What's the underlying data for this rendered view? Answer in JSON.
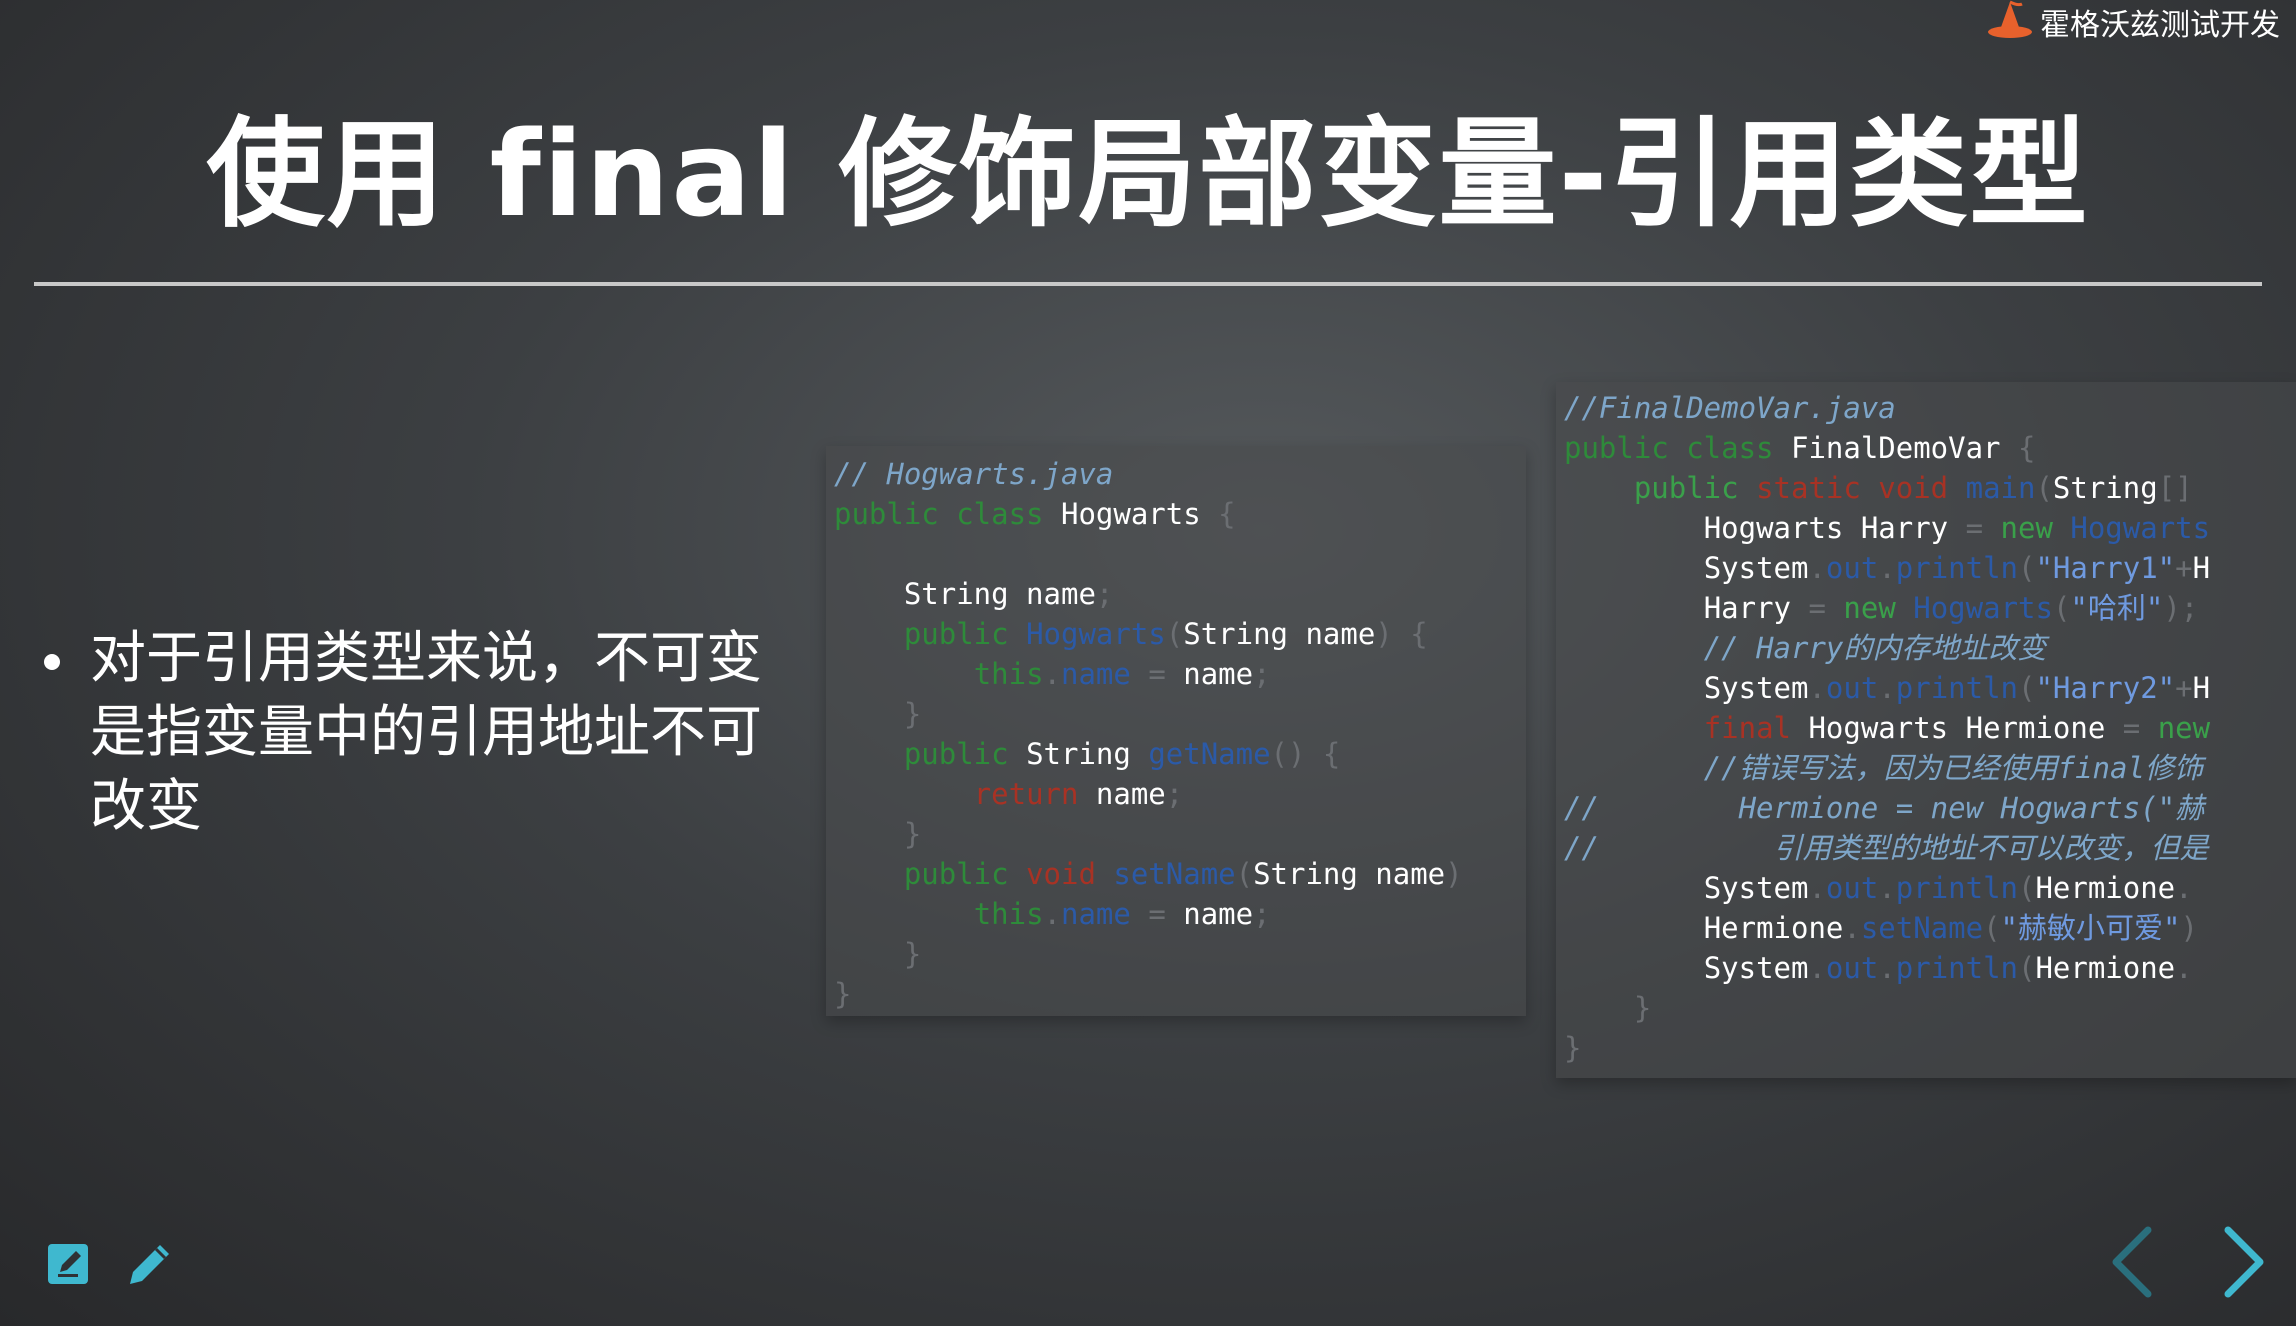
{
  "logo": {
    "text": "霍格沃兹测试开发"
  },
  "slide": {
    "title": "使用 final 修饰局部变量-引用类型",
    "bullet": "对于引用类型来说，不可变是指变量中的引用地址不可改变"
  },
  "code_left": {
    "lines": [
      "// Hogwarts.java",
      "public class Hogwarts {",
      "",
      "    String name;",
      "    public Hogwarts(String name) {",
      "        this.name = name;",
      "    }",
      "    public String getName() {",
      "        return name;",
      "    }",
      "    public void setName(String name)",
      "        this.name = name;",
      "    }",
      "}"
    ]
  },
  "code_right": {
    "lines": [
      "//FinalDemoVar.java",
      "public class FinalDemoVar {",
      "    public static void main(String[]",
      "        Hogwarts Harry = new Hogwarts",
      "        System.out.println(\"Harry1\"+H",
      "        Harry = new Hogwarts(\"哈利\");",
      "        // Harry的内存地址改变",
      "        System.out.println(\"Harry2\"+H",
      "        final Hogwarts Hermione = new",
      "        //错误写法，因为已经使用final修饰",
      "//        Hermione = new Hogwarts(\"赫",
      "//          引用类型的地址不可以改变，但是",
      "        System.out.println(Hermione.",
      "        Hermione.setName(\"赫敏小可爱\")",
      "        System.out.println(Hermione.",
      "    }",
      "}"
    ]
  },
  "colors": {
    "accent": "#3fb8cf",
    "rule": "#c8c8c8",
    "logo_orange": "#e8612c"
  },
  "icons": {
    "edit": "edit-square-icon",
    "pencil": "pencil-icon",
    "prev": "chevron-left-icon",
    "next": "chevron-right-icon"
  }
}
